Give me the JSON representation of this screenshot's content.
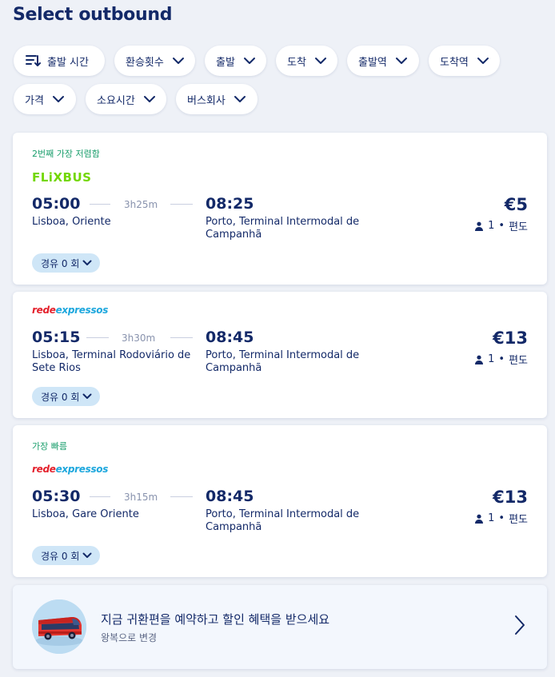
{
  "page": {
    "title": "Select outbound"
  },
  "filters": [
    {
      "label": "출발 시간",
      "icon": "sort-icon"
    },
    {
      "label": "환승횟수",
      "icon": "chevron-down-icon"
    },
    {
      "label": "출발",
      "icon": "chevron-down-icon"
    },
    {
      "label": "도착",
      "icon": "chevron-down-icon"
    },
    {
      "label": "출발역",
      "icon": "chevron-down-icon"
    },
    {
      "label": "도착역",
      "icon": "chevron-down-icon"
    },
    {
      "label": "가격",
      "icon": "chevron-down-icon"
    },
    {
      "label": "소요시간",
      "icon": "chevron-down-icon"
    },
    {
      "label": "버스회사",
      "icon": "chevron-down-icon"
    }
  ],
  "results": [
    {
      "badge": "2번째 가장 저렴함",
      "operator": "FLiXBUS",
      "operator_parts": [
        "",
        ""
      ],
      "depart_time": "05:00",
      "duration": "3h25m",
      "arrive_time": "08:25",
      "from": "Lisboa, Oriente",
      "to": "Porto, Terminal Intermodal de Campanhã",
      "price": "€5",
      "pax_count": "1",
      "pax_dot": "•",
      "trip_type": "편도",
      "stops_label": "경유 0 회"
    },
    {
      "badge": "",
      "operator": "",
      "operator_parts": [
        "rede",
        "expressos"
      ],
      "depart_time": "05:15",
      "duration": "3h30m",
      "arrive_time": "08:45",
      "from": "Lisboa, Terminal Rodoviário de Sete Rios",
      "to": "Porto, Terminal Intermodal de Campanhã",
      "price": "€13",
      "pax_count": "1",
      "pax_dot": "•",
      "trip_type": "편도",
      "stops_label": "경유 0 회"
    },
    {
      "badge": "가장 빠름",
      "operator": "",
      "operator_parts": [
        "rede",
        "expressos"
      ],
      "depart_time": "05:30",
      "duration": "3h15m",
      "arrive_time": "08:45",
      "from": "Lisboa, Gare Oriente",
      "to": "Porto, Terminal Intermodal de Campanhã",
      "price": "€13",
      "pax_count": "1",
      "pax_dot": "•",
      "trip_type": "편도",
      "stops_label": "경유 0 회"
    }
  ],
  "promo": {
    "title": "지금 귀환편을 예약하고 할인 혜택을 받으세요",
    "subtitle": "왕복으로 변경",
    "icon": "bus-illustration"
  },
  "colors": {
    "text": "#132968",
    "badge": "#1a9e6c",
    "flixbus": "#73d700",
    "rede_red": "#e4202b",
    "rede_blue": "#1da7dd",
    "stop_chip": "#cfe6f7"
  }
}
